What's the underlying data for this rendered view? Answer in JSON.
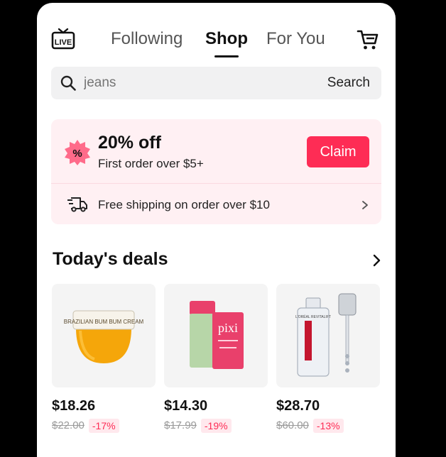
{
  "nav": {
    "live_icon": "live-tv-icon",
    "tabs": [
      {
        "label": "Following",
        "active": false
      },
      {
        "label": "Shop",
        "active": true
      },
      {
        "label": "For You",
        "active": false
      }
    ],
    "cart_icon": "shopping-cart-icon"
  },
  "search": {
    "placeholder": "jeans",
    "button_label": "Search",
    "icon": "search-icon"
  },
  "promo": {
    "title": "20% off",
    "subtitle": "First order over $5+",
    "claim_label": "Claim",
    "badge_icon": "percent-badge-icon",
    "shipping_text": "Free shipping on order over $10",
    "shipping_icon": "delivery-truck-icon",
    "accent_color": "#fe2c55"
  },
  "deals": {
    "title": "Today's deals",
    "products": [
      {
        "price": "$18.26",
        "old_price": "$22.00",
        "discount": "-17%",
        "image_label": "BRAZILIAN BUM BUM CREAM"
      },
      {
        "price": "$14.30",
        "old_price": "$17.99",
        "discount": "-19%",
        "image_label": "pixi"
      },
      {
        "price": "$28.70",
        "old_price": "$60.00",
        "discount": "-13%",
        "image_label": "L'ORÉAL REVITALIFT"
      }
    ]
  }
}
